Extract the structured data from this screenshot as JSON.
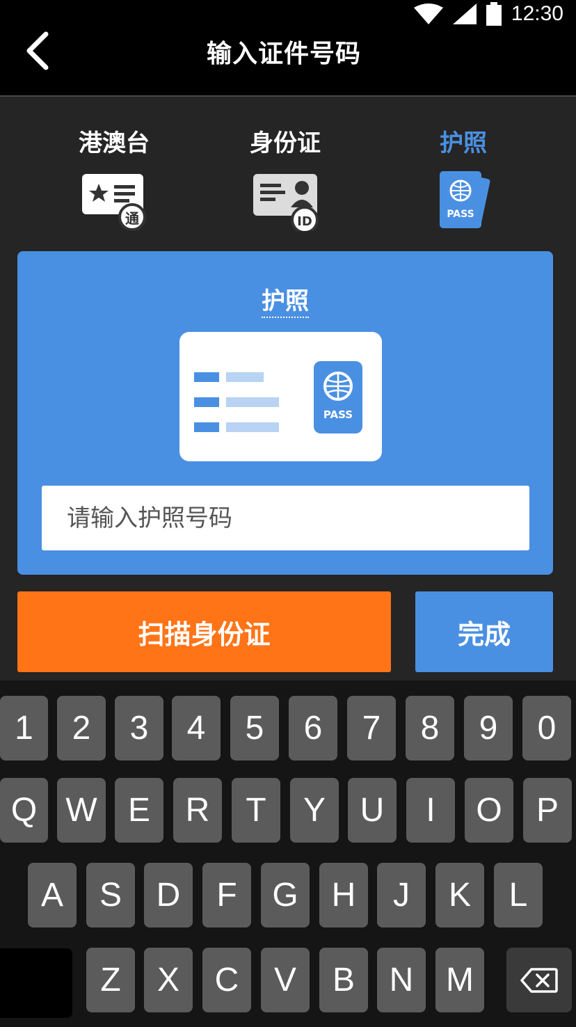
{
  "status_bar": {
    "time": "12:30"
  },
  "header": {
    "title": "输入证件号码"
  },
  "tabs": [
    {
      "label": "港澳台",
      "badge": "通",
      "icon": "hk-permit-card-icon"
    },
    {
      "label": "身份证",
      "badge": "ID",
      "icon": "id-card-icon"
    },
    {
      "label": "护照",
      "icon": "passport-icon",
      "active": true
    }
  ],
  "card": {
    "title": "护照",
    "pass_text": "PASS",
    "input_placeholder": "请输入护照号码"
  },
  "buttons": {
    "scan": "扫描身份证",
    "done": "完成"
  },
  "keyboard": {
    "row1": [
      "1",
      "2",
      "3",
      "4",
      "5",
      "6",
      "7",
      "8",
      "9",
      "0"
    ],
    "row2": [
      "Q",
      "W",
      "E",
      "R",
      "T",
      "Y",
      "U",
      "I",
      "O",
      "P"
    ],
    "row3": [
      "A",
      "S",
      "D",
      "F",
      "G",
      "H",
      "J",
      "K",
      "L"
    ],
    "row4": [
      "Z",
      "X",
      "C",
      "V",
      "B",
      "N",
      "M"
    ]
  },
  "colors": {
    "accent": "#4a90e2",
    "orange": "#ff7417",
    "background": "#252525"
  }
}
